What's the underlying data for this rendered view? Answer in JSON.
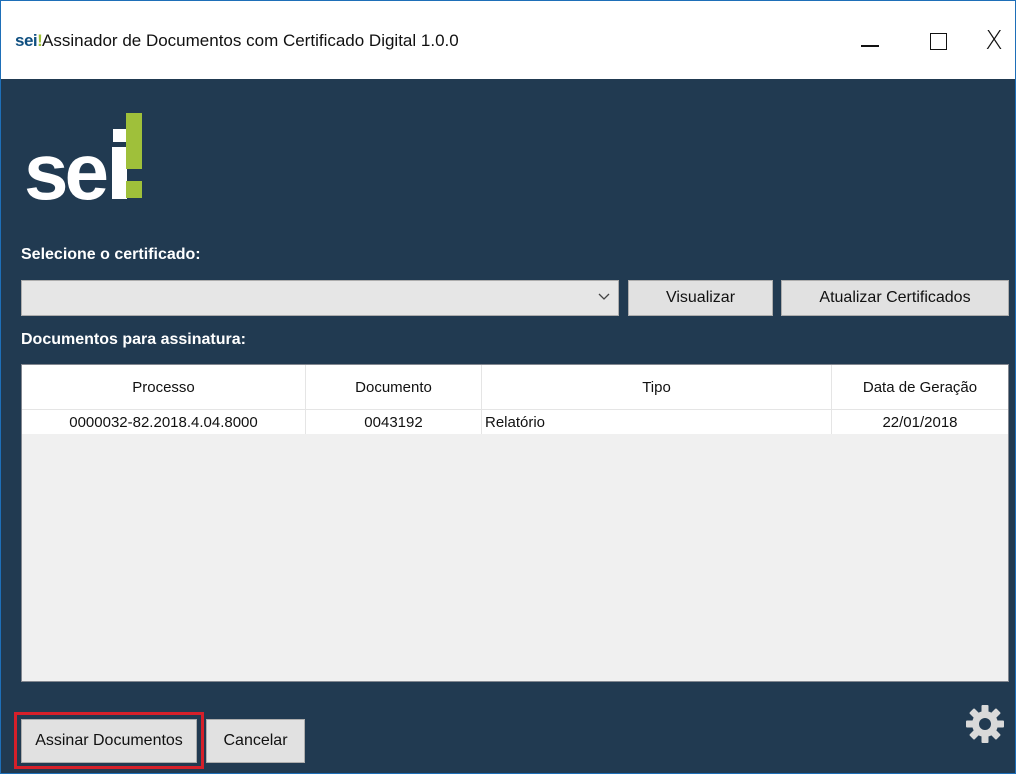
{
  "window": {
    "title_logo": "sei",
    "title_logo_bang": "!",
    "title": "Assinador de Documentos com Certificado Digital 1.0.0",
    "controls": {
      "minimize": "—",
      "maximize": "□",
      "close": "X"
    }
  },
  "logo": {
    "text": "sei!",
    "colors": {
      "main": "#ffffff",
      "accent": "#9fc03a"
    }
  },
  "certificate": {
    "label": "Selecione o certificado:",
    "selected_value": "",
    "dropdown_icon": "chevron-down-icon",
    "visualizar_label": "Visualizar",
    "atualizar_label": "Atualizar Certificados"
  },
  "documents": {
    "label": "Documentos para assinatura:",
    "columns": [
      "Processo",
      "Documento",
      "Tipo",
      "Data de Geração"
    ],
    "rows": [
      [
        "0000032-82.2018.4.04.8000",
        "0043192",
        "Relatório",
        "22/01/2018"
      ]
    ]
  },
  "actions": {
    "assinar_label": "Assinar Documentos",
    "cancelar_label": "Cancelar",
    "settings_icon": "gear-icon"
  },
  "colors": {
    "background": "#213a51",
    "highlight": "#d6202a",
    "brand_blue": "#0f4f80",
    "brand_green": "#9fc03a"
  }
}
